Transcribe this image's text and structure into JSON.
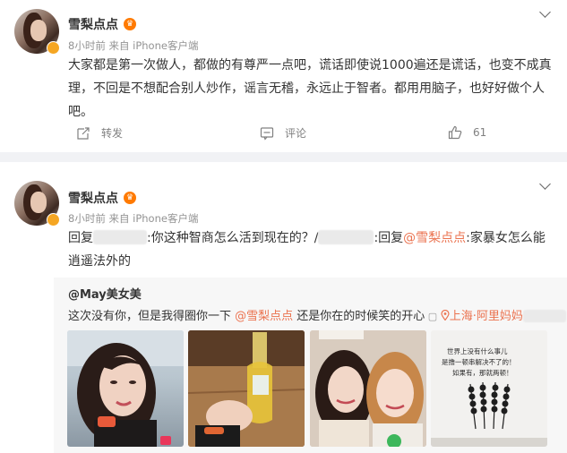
{
  "post1": {
    "username": "雪梨点点",
    "meta": "8小时前  来自 iPhone客户端",
    "text": "大家都是第一次做人，都做的有尊严一点吧，谎话即使说1000遍还是谎话，也变不成真理，不回是不想配合别人炒作，谣言无稽，永远止于智者。都用用脑子，也好好做个人吧。",
    "repost_label": "转发",
    "comment_label": "评论",
    "like_count": "61"
  },
  "post2": {
    "username": "雪梨点点",
    "meta": "8小时前  来自 iPhone客户端",
    "reply_prefix": "回复",
    "reply_text1": ":你这种智商怎么活到现在的？/",
    "reply_text2": ":回复",
    "mention": "@雪梨点点",
    "reply_text3": ":家暴女怎么能逍遥法外的",
    "quoted": {
      "author": "@May美女美",
      "text_before": "这次没有你，但是我得圈你一下 ",
      "mention": "@雪梨点点",
      "text_after": " 还是你在的时候笑的开心",
      "location": "上海·阿里妈妈"
    }
  },
  "photo4_text": "世界上没有什么事儿\n是撸一顿串解决不了的！\n如果有，那就两顿！",
  "icons": {
    "vip_crown": "crown-icon",
    "repost": "repost-icon",
    "comment": "comment-icon",
    "like": "thumbs-up-icon",
    "more": "chevron-down-icon",
    "location": "location-pin-icon"
  },
  "colors": {
    "link": "#eb7350",
    "muted": "#939393",
    "crown": "#ff7a00"
  }
}
